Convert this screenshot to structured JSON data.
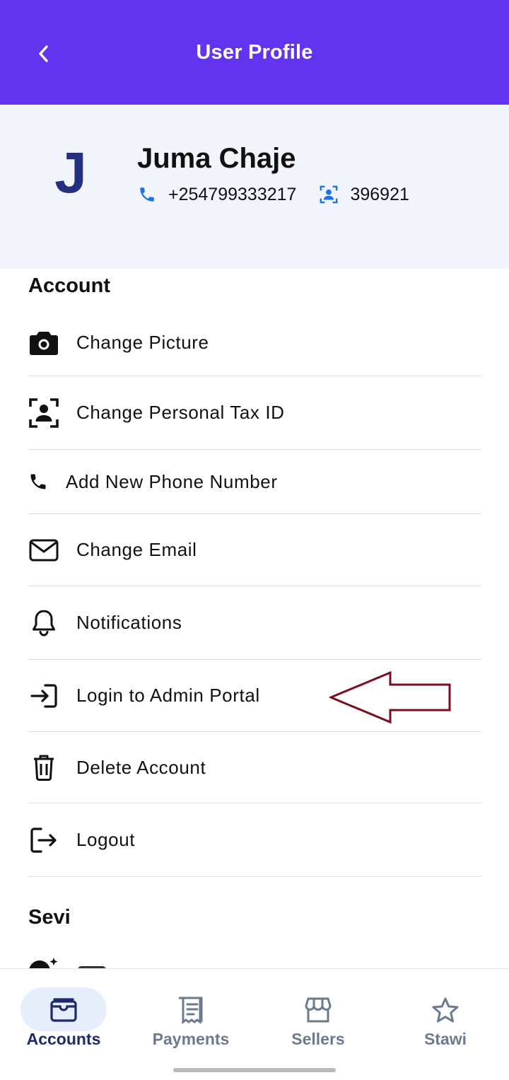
{
  "header": {
    "title": "User Profile",
    "background_color": "#6334ef",
    "back_icon": "chevron-left-icon"
  },
  "profile": {
    "avatar_initial": "J",
    "name": "Juma Chaje",
    "phone": "+254799333217",
    "id_number": "396921",
    "icon_color": "#1a73e8"
  },
  "sections": {
    "account": "Account",
    "sevi": "Sevi"
  },
  "account_menu": [
    {
      "label": "Change Picture",
      "icon": "camera-icon"
    },
    {
      "label": "Change Personal Tax ID",
      "icon": "id-scan-icon"
    },
    {
      "label": "Add New Phone Number",
      "icon": "phone-icon"
    },
    {
      "label": "Change Email",
      "icon": "envelope-icon"
    },
    {
      "label": "Notifications",
      "icon": "bell-icon"
    },
    {
      "label": "Login to Admin Portal",
      "icon": "login-icon"
    },
    {
      "label": "Delete Account",
      "icon": "trash-icon"
    },
    {
      "label": "Logout",
      "icon": "logout-icon"
    }
  ],
  "bottom_nav": [
    {
      "label": "Accounts",
      "icon": "wallet-icon",
      "active": true
    },
    {
      "label": "Payments",
      "icon": "receipt-icon",
      "active": false
    },
    {
      "label": "Sellers",
      "icon": "store-icon",
      "active": false
    },
    {
      "label": "Stawi",
      "icon": "star-icon",
      "active": false
    }
  ],
  "colors": {
    "annotation_arrow": "#7a0e1f",
    "nav_active": "#1d2a6c",
    "nav_inactive": "#6b7a90"
  }
}
